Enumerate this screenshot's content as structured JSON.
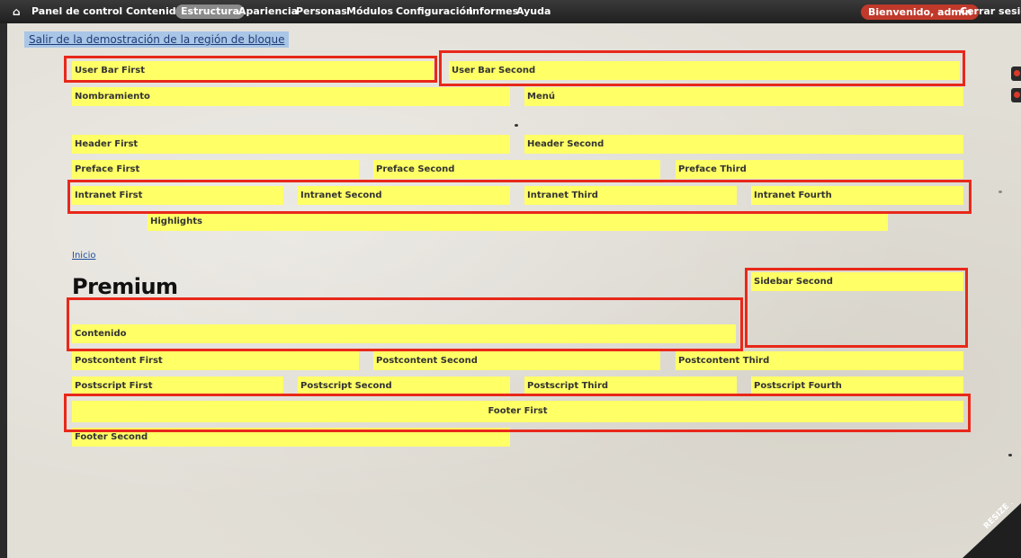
{
  "toolbar": {
    "home_icon": "⌂",
    "items": [
      "Panel de control",
      "Contenido",
      "Estructura",
      "Apariencia",
      "Personas",
      "Módulos",
      "Configuración",
      "Informes",
      "Ayuda"
    ],
    "welcome": "Bienvenido, admin",
    "logout": "Cerrar sesión"
  },
  "demo_exit_link": "Salir de la demostración de la región de bloque",
  "regions": {
    "user_bar_first": "User Bar First",
    "user_bar_second": "User Bar Second",
    "nombramiento": "Nombramiento",
    "menu": "Menú",
    "header_first": "Header First",
    "header_second": "Header Second",
    "preface_first": "Preface First",
    "preface_second": "Preface Second",
    "preface_third": "Preface Third",
    "intranet_first": "Intranet First",
    "intranet_second": "Intranet Second",
    "intranet_third": "Intranet Third",
    "intranet_fourth": "Intranet Fourth",
    "highlights": "Highlights",
    "sidebar_second": "Sidebar Second",
    "contenido": "Contenido",
    "postcontent_first": "Postcontent First",
    "postcontent_second": "Postcontent Second",
    "postcontent_third": "Postcontent Third",
    "postscript_first": "Postscript First",
    "postscript_second": "Postscript Second",
    "postscript_third": "Postscript Third",
    "postscript_fourth": "Postscript Fourth",
    "footer_first": "Footer First",
    "footer_second": "Footer Second"
  },
  "breadcrumb_home": "Inicio",
  "page_title": "Premium",
  "resize_badge": "RESIZE ME",
  "colors": {
    "region_fill": "#ffff66",
    "highlight_border": "#e8281a",
    "toolbar_bg": "#1f1f1f",
    "welcome_badge": "#c0392b"
  }
}
